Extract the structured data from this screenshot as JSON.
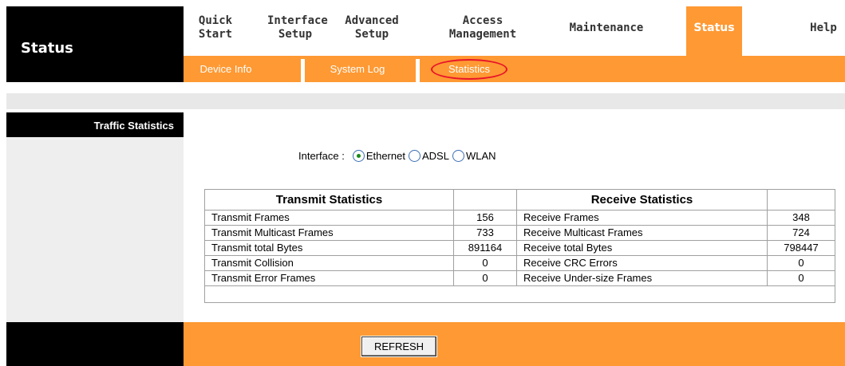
{
  "header": {
    "title": "Status"
  },
  "nav": {
    "items": [
      {
        "label": "Quick\nStart"
      },
      {
        "label": "Interface\nSetup"
      },
      {
        "label": "Advanced\nSetup"
      },
      {
        "label": "Access\nManagement"
      },
      {
        "label": "Maintenance"
      },
      {
        "label": "Status",
        "active": true
      },
      {
        "label": "Help"
      }
    ]
  },
  "subnav": {
    "items": [
      "Device Info",
      "System Log",
      "Statistics"
    ],
    "selected": "Statistics"
  },
  "sidebar": {
    "label": "Traffic Statistics"
  },
  "interface": {
    "label": "Interface :",
    "options": [
      "Ethernet",
      "ADSL",
      "WLAN"
    ],
    "selected": "Ethernet"
  },
  "table": {
    "transmit_header": "Transmit Statistics",
    "receive_header": "Receive Statistics",
    "rows": [
      {
        "tx_label": "Transmit Frames",
        "tx_value": "156",
        "rx_label": "Receive Frames",
        "rx_value": "348"
      },
      {
        "tx_label": "Transmit Multicast Frames",
        "tx_value": "733",
        "rx_label": "Receive Multicast Frames",
        "rx_value": "724"
      },
      {
        "tx_label": "Transmit total Bytes",
        "tx_value": "891164",
        "rx_label": "Receive total Bytes",
        "rx_value": "798447"
      },
      {
        "tx_label": "Transmit Collision",
        "tx_value": "0",
        "rx_label": "Receive CRC Errors",
        "rx_value": "0"
      },
      {
        "tx_label": "Transmit Error Frames",
        "tx_value": "0",
        "rx_label": "Receive Under-size Frames",
        "rx_value": "0"
      }
    ]
  },
  "footer": {
    "refresh_label": "REFRESH"
  },
  "colors": {
    "accent": "#ff9933",
    "header_bg": "#000000",
    "highlight": "#e8152a"
  }
}
